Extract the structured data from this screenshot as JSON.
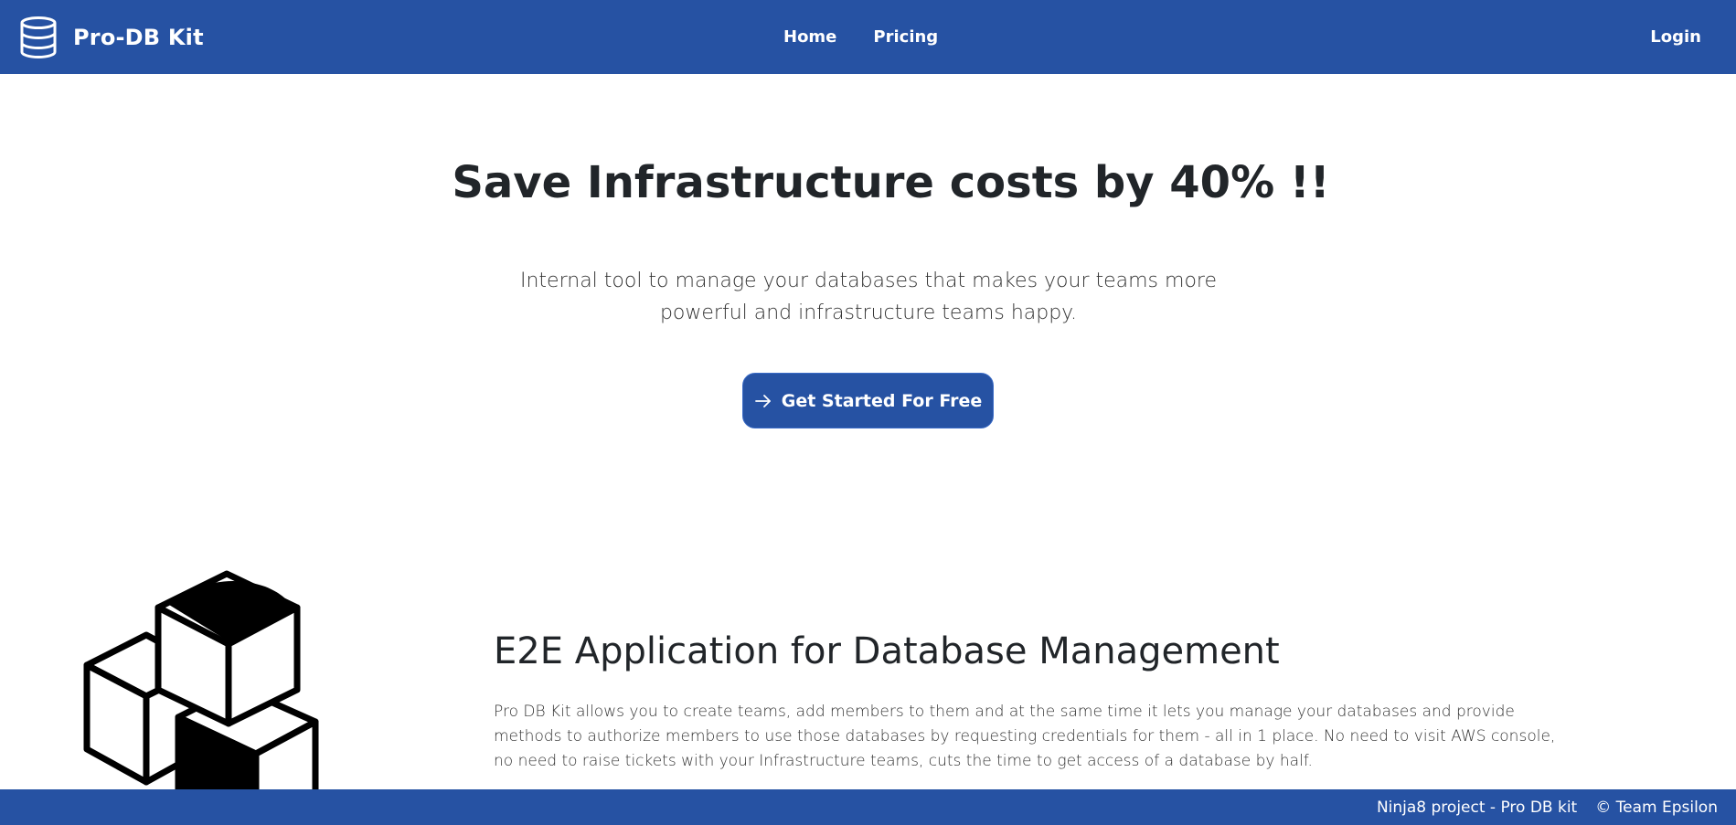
{
  "colors": {
    "brand_blue": "#2652a3",
    "text_dark": "#212529",
    "background": "#ffffff"
  },
  "navbar": {
    "brand_icon": "database-icon",
    "brand_name": "Pro-DB Kit",
    "links": [
      {
        "label": "Home"
      },
      {
        "label": "Pricing"
      }
    ],
    "login_label": "Login"
  },
  "hero": {
    "title": "Save Infrastructure costs by 40% !!",
    "subtitle": "Internal tool to manage your databases that makes your teams more powerful and infrastructure teams happy.",
    "cta_icon": "arrow-right-icon",
    "cta_label": "Get Started For Free"
  },
  "feature": {
    "illustration": "stacked-cubes-illustration",
    "title": "E2E Application for Database Management",
    "text": "Pro DB Kit allows you to create teams, add members to them and at the same time it lets you manage your databases and provide methods to authorize members to use those databases by requesting credentials for them - all in 1 place. No need to visit AWS console, no need to raise tickets with your Infrastructure teams, cuts the time to get access of a database by half."
  },
  "footer": {
    "project": "Ninja8 project - Pro DB kit",
    "credit": "© Team Epsilon"
  }
}
